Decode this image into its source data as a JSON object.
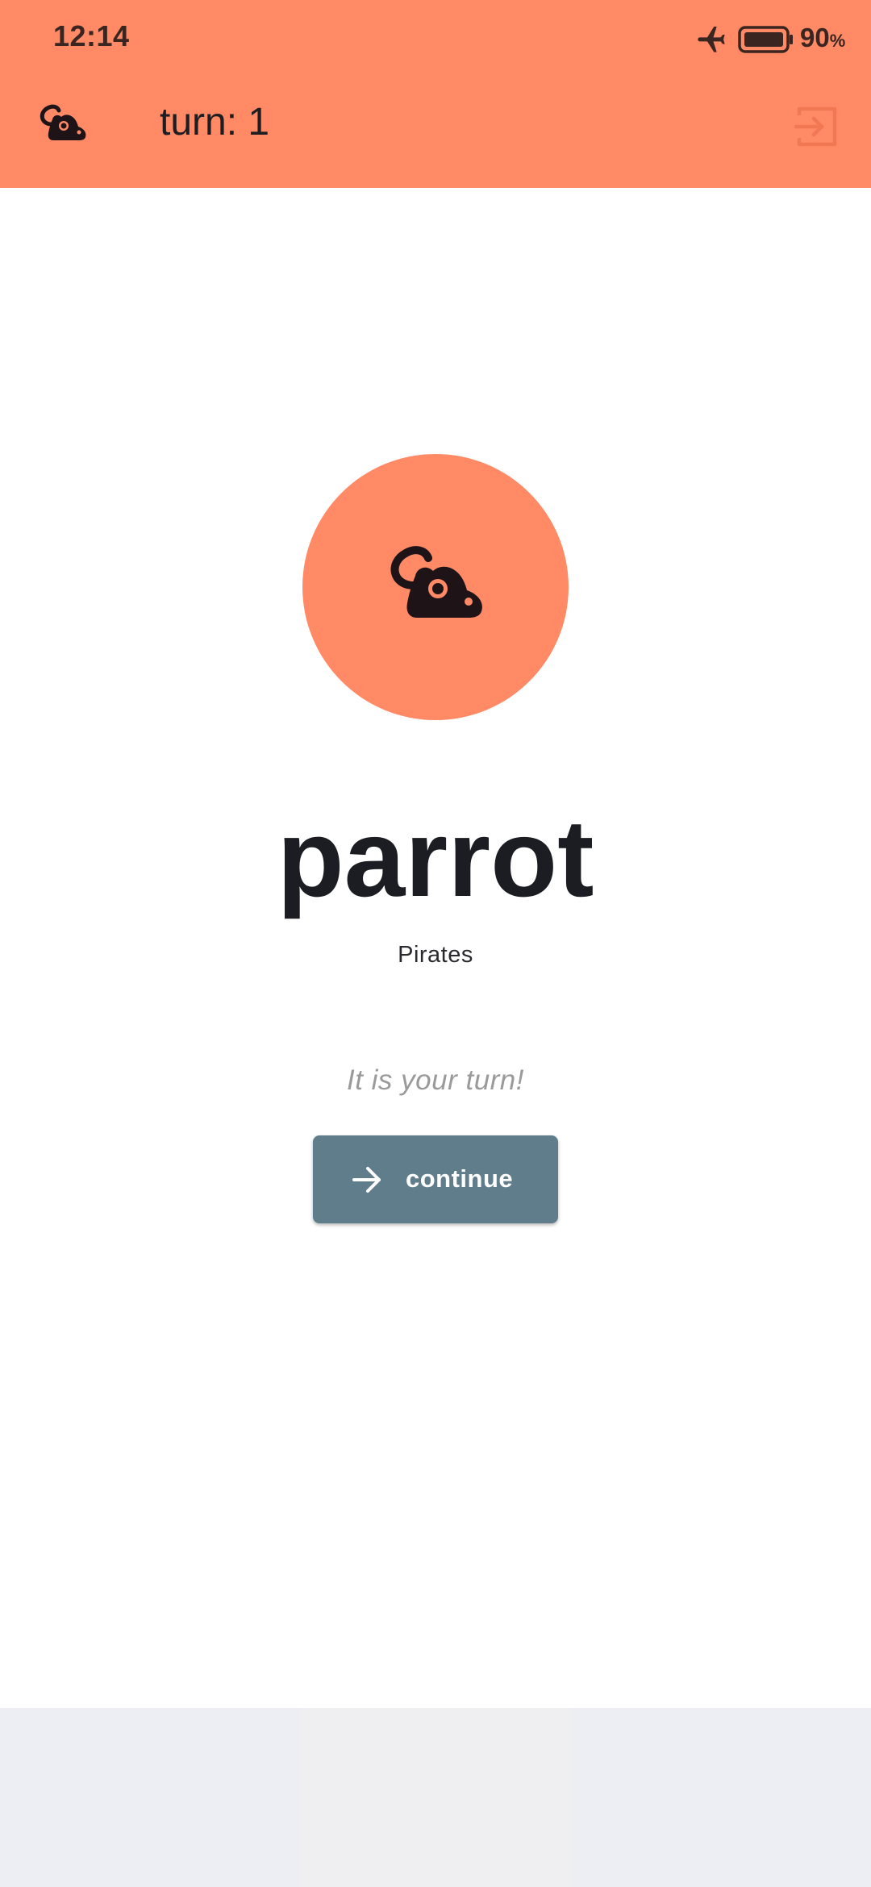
{
  "status_bar": {
    "time": "12:14",
    "battery_level": "90",
    "battery_unit": "%"
  },
  "app_bar": {
    "turn_label": "turn: 1",
    "icons": {
      "leading": "mouse-icon",
      "trailing": "exit-icon"
    }
  },
  "main": {
    "word": "parrot",
    "category": "Pirates",
    "turn_message": "It is your turn!",
    "continue_label": "continue"
  },
  "colors": {
    "accent": "#ff8a65",
    "button": "#607d8b",
    "text_dark": "#1c1d22",
    "bottom_bar": "#edeef3"
  }
}
